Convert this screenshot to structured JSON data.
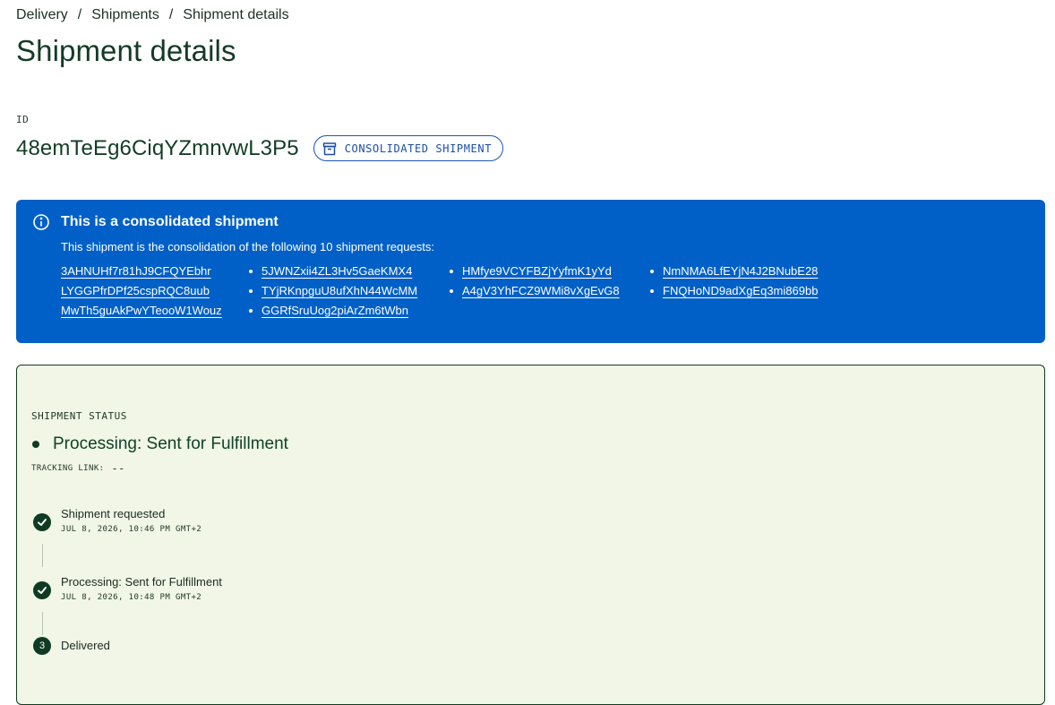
{
  "breadcrumb": {
    "items": [
      "Delivery",
      "Shipments"
    ],
    "current": "Shipment details",
    "separator": "/"
  },
  "page": {
    "title": "Shipment details"
  },
  "shipment": {
    "id_label": "ID",
    "id": "48emTeEg6CiqYZmnvwL3P5",
    "chip": {
      "label": "CONSOLIDATED SHIPMENT",
      "icon": "archive-box-icon"
    }
  },
  "alert": {
    "title": "This is a consolidated shipment",
    "body": "This shipment is the consolidation of the following 10 shipment requests:",
    "icon": "info-circle-icon",
    "color": "#0060c7",
    "requests": [
      "3AHNUHf7r81hJ9CFQYEbhr",
      "5JWNZxii4ZL3Hv5GaeKMX4",
      "HMfye9VCYFBZjYyfmK1yYd",
      "NmNMA6LfEYjN4J2BNubE28",
      "LYGGPfrDPf25cspRQC8uub",
      "TYjRKnpguU8ufXhN44WcMM",
      "A4gV3YhFCZ9WMi8vXgEvG8",
      "FNQHoND9adXgEq3mi869bb",
      "MwTh5guAkPwYTeooW1Wouz",
      "GGRfSruUog2piArZm6tWbn"
    ]
  },
  "status": {
    "label": "SHIPMENT STATUS",
    "current": "Processing: Sent for Fulfillment",
    "tracking_label": "TRACKING LINK:",
    "tracking_value": "--",
    "panel_color": "#f1f6e6",
    "steps": [
      {
        "name": "Shipment requested",
        "time": "JUL 8, 2026, 10:46 PM GMT+2",
        "state": "done",
        "icon": "check-circle-icon"
      },
      {
        "name": "Processing: Sent for Fulfillment",
        "time": "JUL 8, 2026, 10:48 PM GMT+2",
        "state": "done",
        "icon": "check-circle-icon"
      },
      {
        "name": "Delivered",
        "number": "3",
        "state": "pending"
      }
    ]
  }
}
